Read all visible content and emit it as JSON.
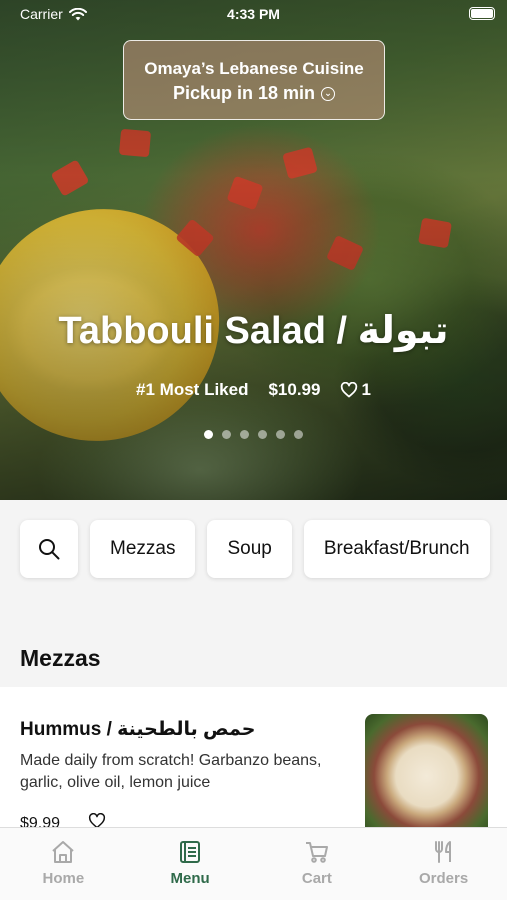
{
  "status_bar": {
    "carrier": "Carrier",
    "time": "4:33 PM"
  },
  "restaurant": {
    "name": "Omaya’s Lebanese Cuisine",
    "pickup": "Pickup in 18 min"
  },
  "featured": {
    "title": "Tabbouli Salad / تبولة",
    "badge": "#1 Most Liked",
    "price": "$10.99",
    "likes": "1",
    "slide_count": 6,
    "active_slide": 1
  },
  "categories": {
    "items": [
      "Mezzas",
      "Soup",
      "Breakfast/Brunch"
    ]
  },
  "section": {
    "title": "Mezzas"
  },
  "menu_item": {
    "name": "Hummus / حمص بالطحينة",
    "description": "Made daily from scratch! Garbanzo beans, garlic, olive oil, lemon juice",
    "price": "$9.99"
  },
  "tabs": [
    {
      "label": "Home",
      "icon": "home-icon",
      "active": false
    },
    {
      "label": "Menu",
      "icon": "menu-icon",
      "active": true
    },
    {
      "label": "Cart",
      "icon": "cart-icon",
      "active": false
    },
    {
      "label": "Orders",
      "icon": "utensils-icon",
      "active": false
    }
  ],
  "colors": {
    "accent": "#2f6a4a",
    "inactive_tab": "#a9a9a9"
  }
}
